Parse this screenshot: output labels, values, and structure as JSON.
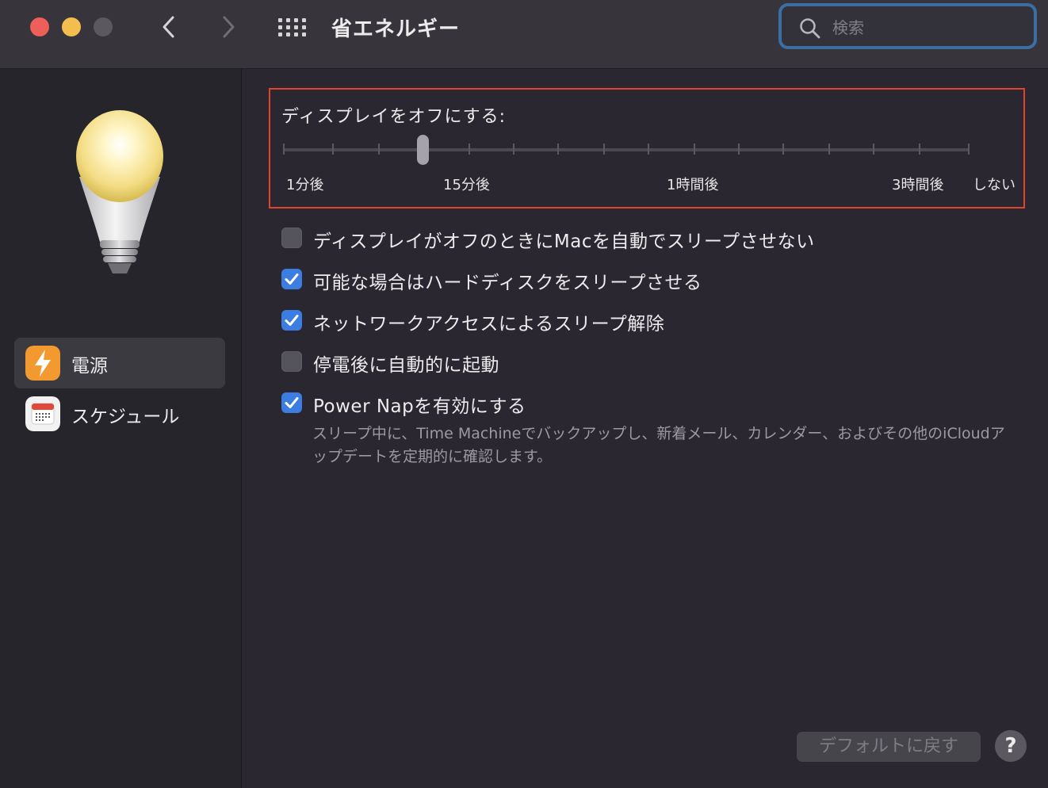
{
  "window": {
    "title": "省エネルギー",
    "search_placeholder": "検索"
  },
  "sidebar": {
    "items": [
      {
        "label": "電源",
        "icon": "bolt-icon",
        "selected": true
      },
      {
        "label": "スケジュール",
        "icon": "calendar-icon",
        "selected": false
      }
    ]
  },
  "display_sleep": {
    "title": "ディスプレイをオフにする:",
    "labels": [
      "1分後",
      "15分後",
      "1時間後",
      "3時間後",
      "しない"
    ],
    "selected_label": "15分後"
  },
  "options": [
    {
      "label": "ディスプレイがオフのときにMacを自動でスリープさせない",
      "checked": false
    },
    {
      "label": "可能な場合はハードディスクをスリープさせる",
      "checked": true
    },
    {
      "label": "ネットワークアクセスによるスリープ解除",
      "checked": true
    },
    {
      "label": "停電後に自動的に起動",
      "checked": false
    },
    {
      "label": "Power Napを有効にする",
      "checked": true
    }
  ],
  "power_nap_description": "スリープ中に、Time Machineでバックアップし、新着メール、カレンダー、およびその他のiCloudアップデートを定期的に確認します。",
  "buttons": {
    "restore_defaults": "デフォルトに戻す",
    "help": "?"
  },
  "colors": {
    "accent": "#3b7de0",
    "highlight_border": "#e0442d",
    "search_focus": "#3b6ea3"
  }
}
